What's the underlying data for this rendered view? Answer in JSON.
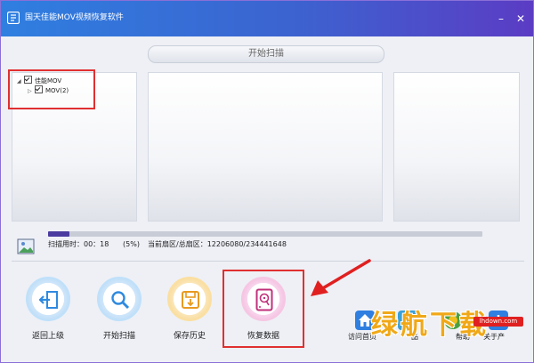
{
  "window": {
    "title": "国天佳能MOV视频恢复软件",
    "minimize_glyph": "–",
    "close_glyph": "✕"
  },
  "scan": {
    "title": "开始扫描"
  },
  "tree": [
    {
      "label": "佳能MOV",
      "checked": true,
      "expanded": true
    },
    {
      "label": "MOV(2)",
      "checked": true,
      "expanded": false
    }
  ],
  "progress": {
    "percent": 5,
    "elapsed_label": "扫描用时：00：18",
    "percent_label": "(5%)",
    "sector_label": "当前扇区/总扇区：12206080/234441648"
  },
  "toolbar": {
    "back": "返回上级",
    "scan": "开始扫描",
    "save_history": "保存历史",
    "recover": "恢复数据"
  },
  "links": {
    "home": "访问首页",
    "product": "品",
    "help": "帮助",
    "about": "关于产"
  },
  "watermark": {
    "text": "绿航下载",
    "site": "lhdown.com"
  },
  "colors": {
    "titlebar_start": "#2f7fe0",
    "titlebar_end": "#5b3cc4",
    "progress_fill": "#4a3ba0",
    "highlight_red": "#e03030",
    "watermark_orange": "#f0a818"
  }
}
